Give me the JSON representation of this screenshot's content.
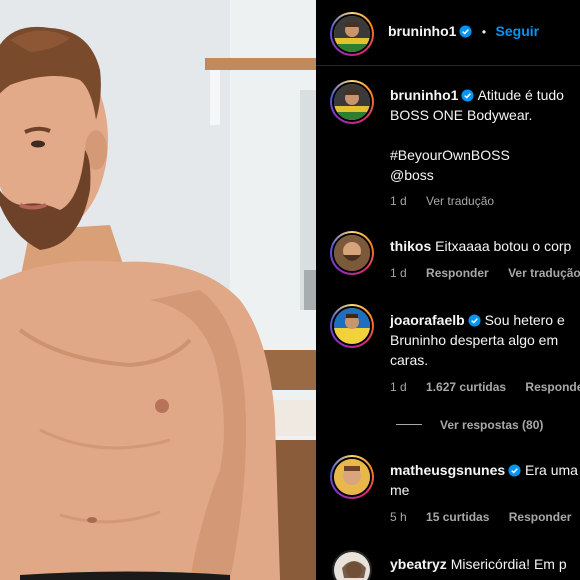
{
  "post": {
    "author": "bruninho1",
    "follow_label": "Seguir",
    "separator": "•",
    "caption_line1": "Atitude é tudo",
    "caption_line2": "BOSS ONE Bodywear.",
    "hashtag": "#BeyourOwnBOSS",
    "mention": "@boss",
    "time": "1 d",
    "translate_label": "Ver tradução"
  },
  "comments": [
    {
      "username": "thikos",
      "verified": false,
      "lines": [
        "Eitxaaaa botou o corp"
      ],
      "time": "1 d",
      "likes": "",
      "reply_label": "Responder",
      "translate_label": "Ver tradução"
    },
    {
      "username": "joaorafaelb",
      "verified": true,
      "lines": [
        "Sou hetero e",
        "Bruninho desperta algo em",
        "caras."
      ],
      "time": "1 d",
      "likes": "1.627 curtidas",
      "reply_label": "Responder",
      "view_replies": "Ver respostas (80)"
    },
    {
      "username": "matheusgsnunes",
      "verified": true,
      "lines": [
        "Era uma",
        "me"
      ],
      "time": "5 h",
      "likes": "15 curtidas",
      "reply_label": "Responder"
    },
    {
      "username": "ybeatryz",
      "verified": false,
      "lines": [
        "Misericórdia! Em p"
      ]
    }
  ],
  "colors": {
    "link": "#0095f6",
    "muted": "#a8a8a8",
    "verified": "#0095f6"
  }
}
